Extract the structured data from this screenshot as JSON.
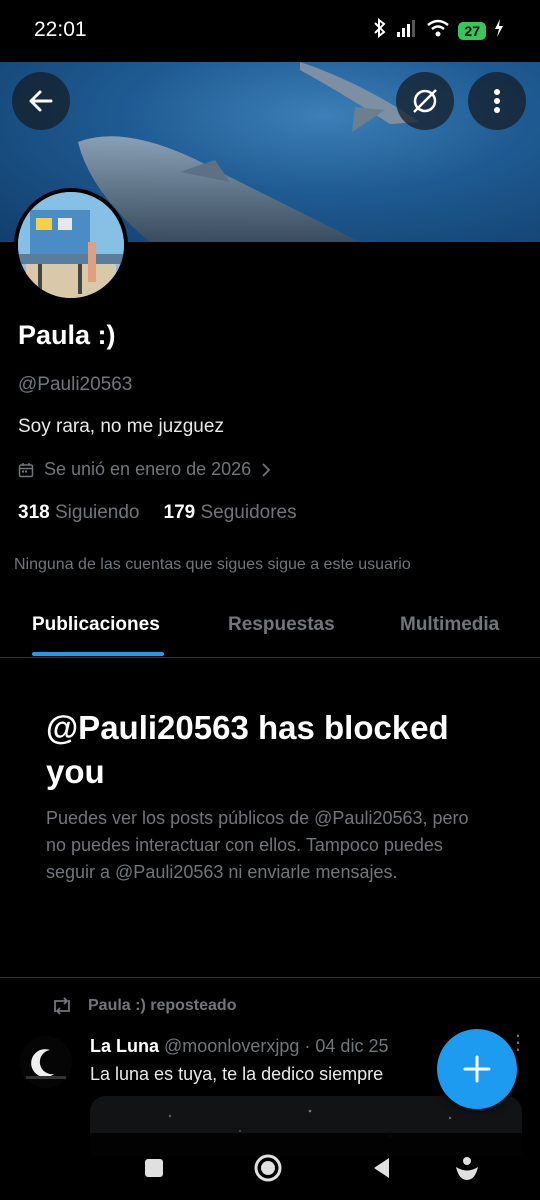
{
  "status_bar": {
    "time": "22:01",
    "battery": "27"
  },
  "profile": {
    "name": "Paula :)",
    "handle": "@Pauli20563",
    "bio": "Soy rara, no me juzguez",
    "joined": "Se unió en enero de 2026",
    "following_count": "318",
    "following_label": "Siguiendo",
    "followers_count": "179",
    "followers_label": "Seguidores",
    "mutual_note": "Ninguna de las cuentas que sigues sigue a este usuario"
  },
  "tabs": [
    {
      "label": "Publicaciones",
      "active": true
    },
    {
      "label": "Respuestas",
      "active": false
    },
    {
      "label": "Multimedia",
      "active": false
    }
  ],
  "blocked": {
    "title": "@Pauli20563 has blocked you",
    "description": "Puedes ver los posts públicos de @Pauli20563, pero no puedes interactuar con ellos. Tampoco puedes seguir a @Pauli20563 ni enviarle mensajes."
  },
  "post": {
    "repost_label": "Paula :) reposteado",
    "author_name": "La Luna",
    "author_handle": "@moonloverxjpg",
    "separator": "·",
    "date": "04 dic 25",
    "text": "La luna es tuya, te la dedico siempre",
    "more": "⋮"
  },
  "icons": {
    "back": "arrow-left-icon",
    "grok": "slash-circle-icon",
    "menu": "more-vertical-icon",
    "calendar": "calendar-icon",
    "chevron": "chevron-right-icon",
    "repost": "repost-icon",
    "compose": "plus-icon"
  },
  "colors": {
    "accent": "#1d9bf0",
    "background": "#000000",
    "muted": "#71767b"
  }
}
